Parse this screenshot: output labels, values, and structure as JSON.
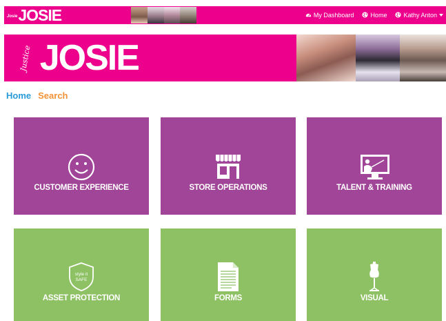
{
  "topbar": {
    "logo_text": "JOSIE",
    "logo_tiny": "Josie",
    "nav": [
      {
        "label": "My Dashboard",
        "icon": "dashboard-icon"
      },
      {
        "label": "Home",
        "icon": "globe-icon"
      },
      {
        "label": "Kathy Anton",
        "icon": "globe-icon"
      }
    ]
  },
  "banner": {
    "logo_text": "JOSIE",
    "logo_script": "Justice"
  },
  "breadcrumb": {
    "home": "Home",
    "search": "Search"
  },
  "tiles": [
    {
      "label": "CUSTOMER EXPERIENCE",
      "icon": "smiley-icon",
      "color": "#a04598"
    },
    {
      "label": "STORE OPERATIONS",
      "icon": "storefront-icon",
      "color": "#a04598"
    },
    {
      "label": "TALENT & TRAINING",
      "icon": "presentation-icon",
      "color": "#a04598"
    },
    {
      "label": "ASSET PROTECTION",
      "icon": "shield-icon",
      "color": "#8dc163",
      "badge": [
        "style it",
        "SAFE"
      ]
    },
    {
      "label": "FORMS",
      "icon": "document-icon",
      "color": "#8dc163"
    },
    {
      "label": "VISUAL",
      "icon": "mannequin-icon",
      "color": "#8dc163"
    }
  ],
  "colors": {
    "brand_pink": "#ec008c",
    "tile_purple": "#a04598",
    "tile_green": "#8dc163",
    "link_blue": "#2a9bd8",
    "link_orange": "#f39237"
  }
}
